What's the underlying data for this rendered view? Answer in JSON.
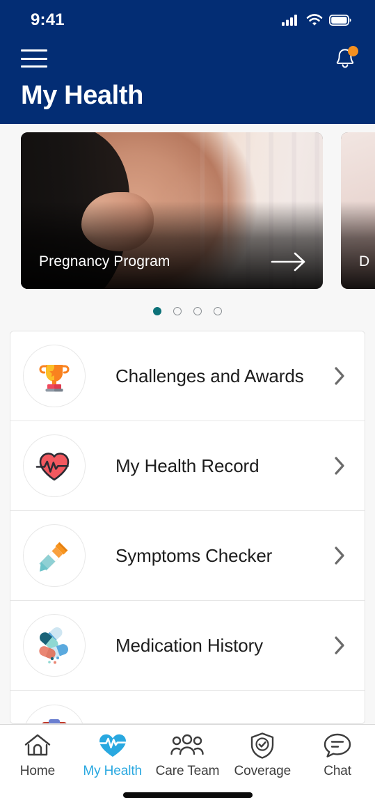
{
  "status_bar": {
    "time": "9:41",
    "icons": [
      "cellular-signal-icon",
      "wifi-icon",
      "battery-icon"
    ]
  },
  "header": {
    "background_color": "#032d74",
    "menu_icon": "hamburger-menu-icon",
    "notifications_icon": "notification-bell-icon",
    "notification_badge_color": "#f5901f",
    "has_notification_badge": true,
    "title": "My Health"
  },
  "carousel": {
    "cards": [
      {
        "label": "Pregnancy Program",
        "image": "pregnant-belly-photo",
        "arrow_icon": "arrow-right-icon"
      },
      {
        "label": "D",
        "image": "baby-skin-photo",
        "arrow_icon": "arrow-right-icon"
      }
    ],
    "pagination": {
      "total": 4,
      "active_index": 0,
      "active_color": "#0d7279",
      "inactive_color": "#8d9296"
    }
  },
  "menu": {
    "items": [
      {
        "label": "Challenges and Awards",
        "icon": "trophy-icon",
        "chevron": "chevron-right-icon"
      },
      {
        "label": "My Health Record",
        "icon": "heart-pulse-icon",
        "chevron": "chevron-right-icon"
      },
      {
        "label": "Symptoms Checker",
        "icon": "dropper-icon",
        "chevron": "chevron-right-icon"
      },
      {
        "label": "Medication History",
        "icon": "pills-capsules-icon",
        "chevron": "chevron-right-icon"
      },
      {
        "label": "",
        "icon": "clipboard-icon",
        "chevron": "chevron-right-icon"
      }
    ]
  },
  "tabbar": {
    "active_color": "#29a8e0",
    "inactive_color": "#3d3d3d",
    "tabs": [
      {
        "label": "Home",
        "icon": "home-icon",
        "active": false
      },
      {
        "label": "My Health",
        "icon": "heart-pulse-icon",
        "active": true
      },
      {
        "label": "Care Team",
        "icon": "people-group-icon",
        "active": false
      },
      {
        "label": "Coverage",
        "icon": "shield-check-icon",
        "active": false
      },
      {
        "label": "Chat",
        "icon": "chat-bubble-icon",
        "active": false
      }
    ]
  }
}
